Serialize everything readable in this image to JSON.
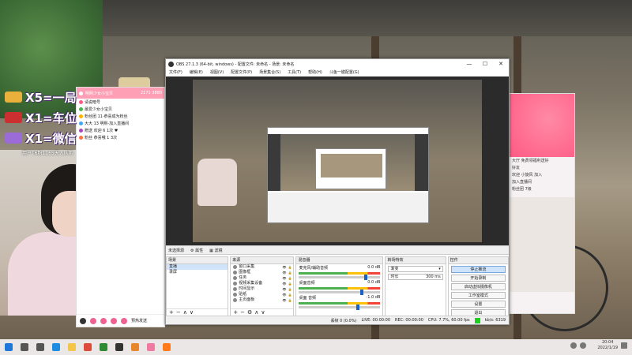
{
  "overlay": {
    "rows": [
      {
        "text": "X5=一局",
        "icon": "gold-bar-icon",
        "color": "#e9b13c"
      },
      {
        "text": "X1=车位",
        "icon": "airplane-icon",
        "color": "#cc2f2f"
      },
      {
        "text": "X1=微信",
        "icon": "crystal-icon",
        "color": "#9b6bd8"
      }
    ],
    "sub_text": "用户T6粉1165天入队哟"
  },
  "chat_left": {
    "title": "明熙少女小宝贝",
    "viewers": "2171 3880",
    "lines": [
      "请说暗号",
      "最爱少女小宝贝",
      "粉丝团 11·恭喜成为粉丝",
      "大大   13   明熙·加入直播间",
      "赠送 欢迎 6 1次 ♥",
      "粉丝 恭喜哦 1 3次"
    ],
    "gift_button": "预热发送"
  },
  "chat_right": {
    "lines": [
      "大厅 免费领福利送好",
      "好友",
      "欢迎 小旋风 加入",
      "加入直播间",
      "粉丝团 7级"
    ]
  },
  "obs": {
    "title": "OBS 27.1.3 (64-bit, windows) - 配置文件: 未命名 - 场景: 未命名",
    "menu": [
      "文件(F)",
      "编辑(E)",
      "视图(V)",
      "配置文件(P)",
      "场景集合(S)",
      "工具(T)",
      "帮助(H)",
      "斗鱼一键配置(G)"
    ],
    "window_controls": {
      "min": "—",
      "max": "☐",
      "close": "✕"
    },
    "scene_bar": {
      "label": "未选择源",
      "properties": "属性",
      "filters": "滤镜"
    },
    "scenes": {
      "title": "场景",
      "items": [
        "直播",
        "录屏"
      ]
    },
    "sources": {
      "title": "来源",
      "items": [
        "窗口采集",
        "图像框",
        "任务",
        "视频采集设备",
        "时间显示",
        "贴纸",
        "主页面板"
      ]
    },
    "mixer": {
      "title": "混音器",
      "channels": [
        {
          "name": "麦克风/辅助音频",
          "db": "0.0 dB",
          "level": 0.8
        },
        {
          "name": "桌面音频",
          "db": "0.0 dB",
          "level": 0.75
        },
        {
          "name": "桌面 音频",
          "db": "-1.0 dB",
          "level": 0.7
        }
      ]
    },
    "transitions": {
      "title": "转场特效",
      "mode": "渐变",
      "duration_label": "时长",
      "duration": "300 ms"
    },
    "controls": {
      "title": "控件",
      "buttons": [
        "停止推流",
        "开始录制",
        "启动虚拟摄像机",
        "工作室模式",
        "设置",
        "退出"
      ]
    },
    "status": {
      "dropped": "丢帧 0 (0.0%)",
      "live": "LIVE: 00:00:00",
      "rec": "REC: 00:00:00",
      "cpu": "CPU: 7.7%, 60.00 fps",
      "bitrate": "kb/s: 6319"
    }
  },
  "taskbar": {
    "time": "20:04",
    "date": "2022/1/19",
    "apps": [
      {
        "icon": "windows-start-icon",
        "color": "#1e78d7"
      },
      {
        "icon": "search-icon",
        "color": "#555555"
      },
      {
        "icon": "task-view-icon",
        "color": "#555555"
      },
      {
        "icon": "edge-icon",
        "color": "#1b8ce0"
      },
      {
        "icon": "file-explorer-icon",
        "color": "#f3c64a"
      },
      {
        "icon": "chrome-icon",
        "color": "#de4a3a"
      },
      {
        "icon": "media-player-icon",
        "color": "#2f8a33"
      },
      {
        "icon": "obs-icon",
        "color": "#333333"
      },
      {
        "icon": "game-icon",
        "color": "#e9862b"
      },
      {
        "icon": "bilibili-icon",
        "color": "#f07aa0"
      },
      {
        "icon": "douyu-icon",
        "color": "#ff7a1a"
      }
    ]
  }
}
